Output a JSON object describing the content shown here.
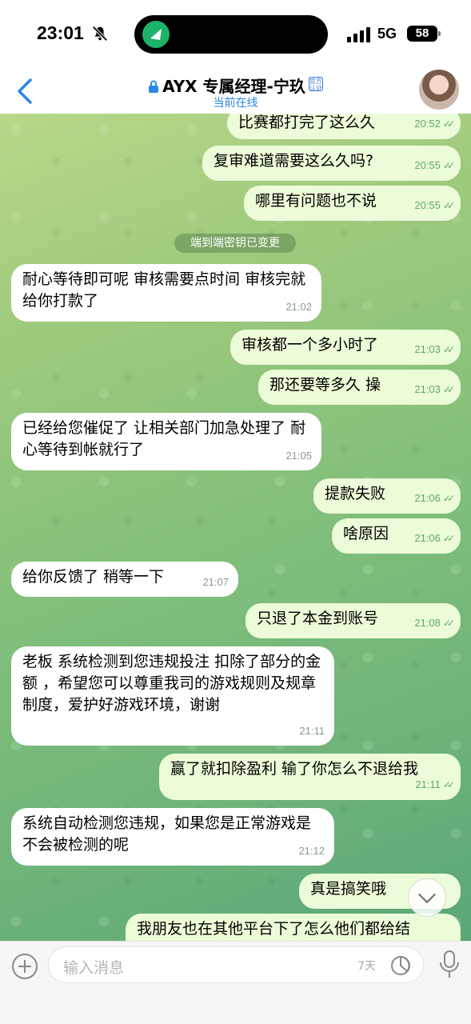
{
  "status_bar": {
    "time": "23:01",
    "network": "5G",
    "battery": "58"
  },
  "header": {
    "back_icon": "chevron-left-icon",
    "title": "AYX 专属经理-宁玖",
    "badge": "官方认证",
    "status": "当前在线",
    "accent_color": "#2a86e8"
  },
  "chat": {
    "system_notice": "端到端密钥已变更",
    "messages": [
      {
        "dir": "out",
        "text": "比赛都打完了这么久",
        "time": "20:52"
      },
      {
        "dir": "out",
        "text": "复审难道需要这么久吗?",
        "time": "20:55"
      },
      {
        "dir": "out",
        "text": "哪里有问题也不说",
        "time": "20:55"
      },
      {
        "dir": "in",
        "text": "耐心等待即可呢  审核需要点时间 审核完就给你打款了",
        "time": "21:02"
      },
      {
        "dir": "out",
        "text": "审核都一个多小时了",
        "time": "21:03"
      },
      {
        "dir": "out",
        "text": "那还要等多久 操",
        "time": "21:03"
      },
      {
        "dir": "in",
        "text": "已经给您催促了   让相关部门加急处理了  耐心等待到帐就行了",
        "time": "21:05"
      },
      {
        "dir": "out",
        "text": "提款失败",
        "time": "21:06"
      },
      {
        "dir": "out",
        "text": "啥原因",
        "time": "21:06"
      },
      {
        "dir": "in",
        "text": "给你反馈了  稍等一下",
        "time": "21:07"
      },
      {
        "dir": "out",
        "text": "只退了本金到账号",
        "time": "21:08"
      },
      {
        "dir": "in",
        "text": "老板  系统检测到您违规投注  扣除了部分的金额  ，希望您可以尊重我司的游戏规则及规章制度，爱护好游戏环境，谢谢",
        "time": "21:11"
      },
      {
        "dir": "out",
        "text": "赢了就扣除盈利 输了你怎么不退给我",
        "time": "21:11"
      },
      {
        "dir": "in",
        "text": "系统自动检测您违规，如果您是正常游戏是不会被检测的呢",
        "time": "21:12"
      },
      {
        "dir": "out",
        "text": "真是搞笑哦",
        "time": ""
      },
      {
        "dir": "out",
        "text": "我朋友也在其他平台下了怎么他们都给结",
        "time": ""
      }
    ],
    "outgoing_bubble_color": "#ecfcd8",
    "incoming_bubble_color": "#ffffff"
  },
  "input_bar": {
    "placeholder": "输入消息",
    "timer_label": "7天"
  }
}
